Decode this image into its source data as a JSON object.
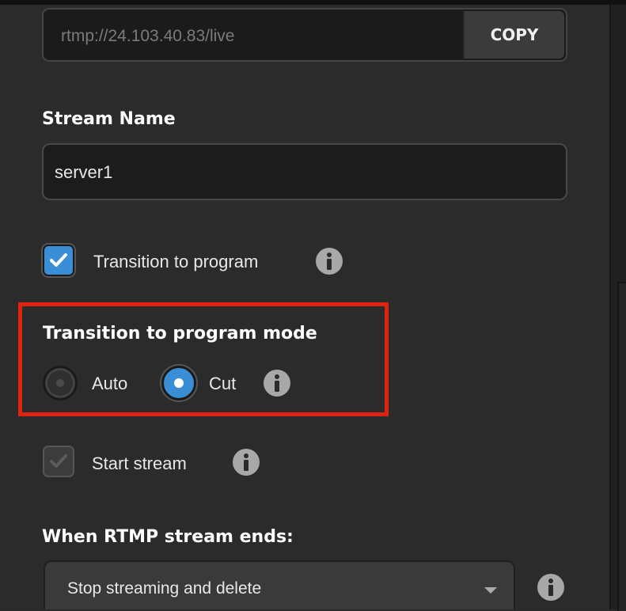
{
  "server": {
    "url": "rtmp://24.103.40.83/live",
    "copy_label": "COPY"
  },
  "stream_name": {
    "heading": "Stream Name",
    "value": "server1"
  },
  "transition_to_program": {
    "label": "Transition to program",
    "checked": true
  },
  "transition_mode": {
    "heading": "Transition to program mode",
    "options": [
      {
        "label": "Auto",
        "selected": false
      },
      {
        "label": "Cut",
        "selected": true
      }
    ]
  },
  "start_stream": {
    "label": "Start stream",
    "checked": true,
    "disabled": true
  },
  "on_end": {
    "heading": "When RTMP stream ends:",
    "selected": "Stop streaming and delete"
  },
  "colors": {
    "accent": "#3a8ed6",
    "highlight": "#e2210f",
    "panel": "#2b2b2b"
  },
  "icons": [
    "checkmark-icon",
    "info-icon",
    "chevron-down-icon"
  ]
}
